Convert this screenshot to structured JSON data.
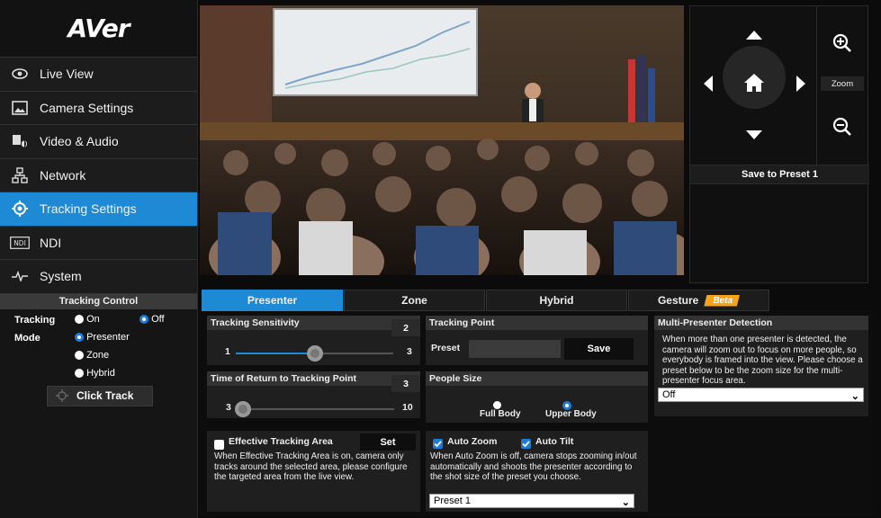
{
  "brand": {
    "logo": "AVer"
  },
  "nav": [
    {
      "label": "Live View",
      "icon": "eye-icon"
    },
    {
      "label": "Camera Settings",
      "icon": "image-icon"
    },
    {
      "label": "Video & Audio",
      "icon": "video-audio-icon"
    },
    {
      "label": "Network",
      "icon": "network-icon"
    },
    {
      "label": "Tracking Settings",
      "icon": "target-icon",
      "active": true
    },
    {
      "label": "NDI",
      "icon": "ndi-icon"
    },
    {
      "label": "System",
      "icon": "pulse-icon"
    }
  ],
  "tracking_control": {
    "title": "Tracking Control",
    "tracking_label": "Tracking",
    "on_label": "On",
    "off_label": "Off",
    "selected_state": "Off",
    "mode_label": "Mode",
    "modes": [
      "Presenter",
      "Zone",
      "Hybrid"
    ],
    "selected_mode": "Presenter",
    "click_track_label": "Click Track"
  },
  "ptz": {
    "zoom_label": "Zoom",
    "save_preset_label": "Save to Preset 1"
  },
  "tabs": [
    {
      "label": "Presenter",
      "active": true
    },
    {
      "label": "Zone"
    },
    {
      "label": "Hybrid"
    },
    {
      "label": "Gesture",
      "badge": "Beta"
    }
  ],
  "sensitivity": {
    "title": "Tracking Sensitivity",
    "value": "2",
    "min": "1",
    "max": "3",
    "level": 0.5
  },
  "return_time": {
    "title": "Time of Return to Tracking Point",
    "value": "3",
    "min": "3",
    "max": "10",
    "level": 0.0
  },
  "effective_area": {
    "label": "Effective Tracking Area",
    "checked": false,
    "set_label": "Set",
    "description": "When Effective Tracking Area is on, camera only tracks around the selected area, please configure the targeted area from the live view."
  },
  "tracking_point": {
    "title": "Tracking Point",
    "preset_label": "Preset",
    "save_label": "Save"
  },
  "people_size": {
    "title": "People Size",
    "options": [
      "Full Body",
      "Upper Body"
    ],
    "selected": "Upper Body"
  },
  "auto": {
    "zoom_label": "Auto Zoom",
    "tilt_label": "Auto Tilt",
    "zoom_checked": true,
    "tilt_checked": true,
    "description": "When Auto Zoom is off, camera stops zooming in/out automatically and shoots the presenter according to the shot size of the preset you choose.",
    "preset_value": "Preset 1"
  },
  "multi_presenter": {
    "title": "Multi-Presenter Detection",
    "description": "When more than one presenter is detected, the camera will zoom out to focus on more people, so everybody is framed into the view. Please choose a preset below to be the zoom size for the multi-presenter focus area.",
    "value": "Off"
  },
  "colors": {
    "accent": "#1e8ad6",
    "beta": "#f5a318",
    "bg": "#0b0b0b"
  }
}
